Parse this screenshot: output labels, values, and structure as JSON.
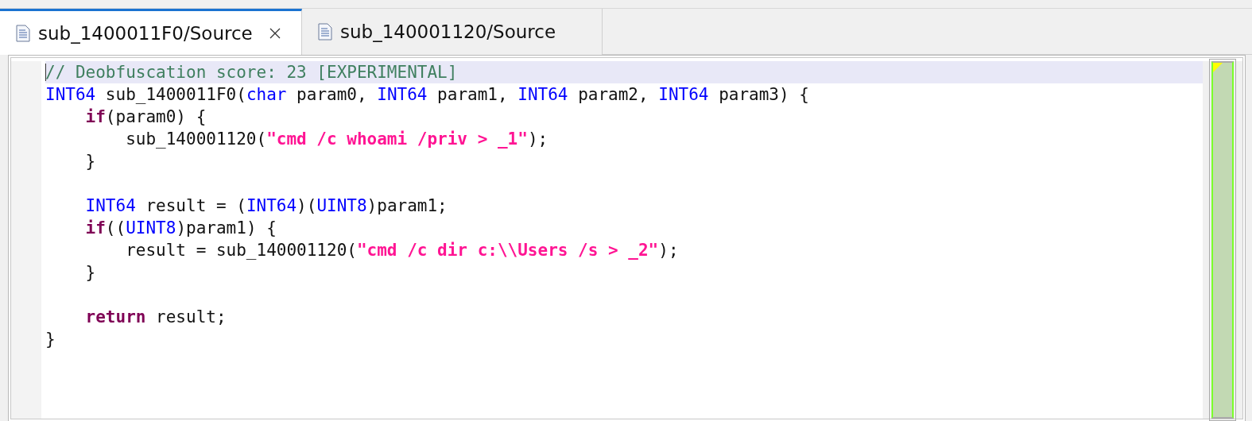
{
  "tabs": [
    {
      "label": "sub_1400011F0/Source",
      "selected": true,
      "closable": true
    },
    {
      "label": "sub_140001120/Source",
      "selected": false,
      "closable": false
    }
  ],
  "code": {
    "lines": [
      {
        "current": true,
        "blank_line_before": false,
        "tokens": [
          {
            "text": "// Deobfuscation score: 23 [EXPERIMENTAL]",
            "kind": "comment"
          }
        ]
      },
      {
        "current": false,
        "blank_line_before": false,
        "tokens": [
          {
            "text": "INT64",
            "kind": "type"
          },
          {
            "text": " sub_1400011F0(",
            "kind": "plain"
          },
          {
            "text": "char",
            "kind": "type"
          },
          {
            "text": " param0, ",
            "kind": "plain"
          },
          {
            "text": "INT64",
            "kind": "type"
          },
          {
            "text": " param1, ",
            "kind": "plain"
          },
          {
            "text": "INT64",
            "kind": "type"
          },
          {
            "text": " param2, ",
            "kind": "plain"
          },
          {
            "text": "INT64",
            "kind": "type"
          },
          {
            "text": " param3) {",
            "kind": "plain"
          }
        ]
      },
      {
        "current": false,
        "blank_line_before": false,
        "tokens": [
          {
            "text": "    if",
            "kind": "keyword"
          },
          {
            "text": "(param0) {",
            "kind": "plain"
          }
        ]
      },
      {
        "current": false,
        "blank_line_before": false,
        "tokens": [
          {
            "text": "        sub_140001120(",
            "kind": "plain"
          },
          {
            "text": "\"cmd /c whoami /priv > _1\"",
            "kind": "string"
          },
          {
            "text": ");",
            "kind": "plain"
          }
        ]
      },
      {
        "current": false,
        "blank_line_before": false,
        "tokens": [
          {
            "text": "    }",
            "kind": "plain"
          }
        ]
      },
      {
        "current": false,
        "blank_line_before": true,
        "tokens": [
          {
            "text": "    INT64",
            "kind": "type"
          },
          {
            "text": " result = (",
            "kind": "plain"
          },
          {
            "text": "INT64",
            "kind": "type"
          },
          {
            "text": ")(",
            "kind": "plain"
          },
          {
            "text": "UINT8",
            "kind": "type"
          },
          {
            "text": ")param1;",
            "kind": "plain"
          }
        ]
      },
      {
        "current": false,
        "blank_line_before": false,
        "tokens": [
          {
            "text": "    if",
            "kind": "keyword"
          },
          {
            "text": "((",
            "kind": "plain"
          },
          {
            "text": "UINT8",
            "kind": "type"
          },
          {
            "text": ")param1) {",
            "kind": "plain"
          }
        ]
      },
      {
        "current": false,
        "blank_line_before": false,
        "tokens": [
          {
            "text": "        result = sub_140001120(",
            "kind": "plain"
          },
          {
            "text": "\"cmd /c dir c:\\\\Users /s > _2\"",
            "kind": "string"
          },
          {
            "text": ");",
            "kind": "plain"
          }
        ]
      },
      {
        "current": false,
        "blank_line_before": false,
        "tokens": [
          {
            "text": "    }",
            "kind": "plain"
          }
        ]
      },
      {
        "current": false,
        "blank_line_before": true,
        "tokens": [
          {
            "text": "    return",
            "kind": "keyword"
          },
          {
            "text": " result;",
            "kind": "plain"
          }
        ]
      },
      {
        "current": false,
        "blank_line_before": false,
        "tokens": [
          {
            "text": "}",
            "kind": "plain"
          }
        ]
      }
    ]
  }
}
